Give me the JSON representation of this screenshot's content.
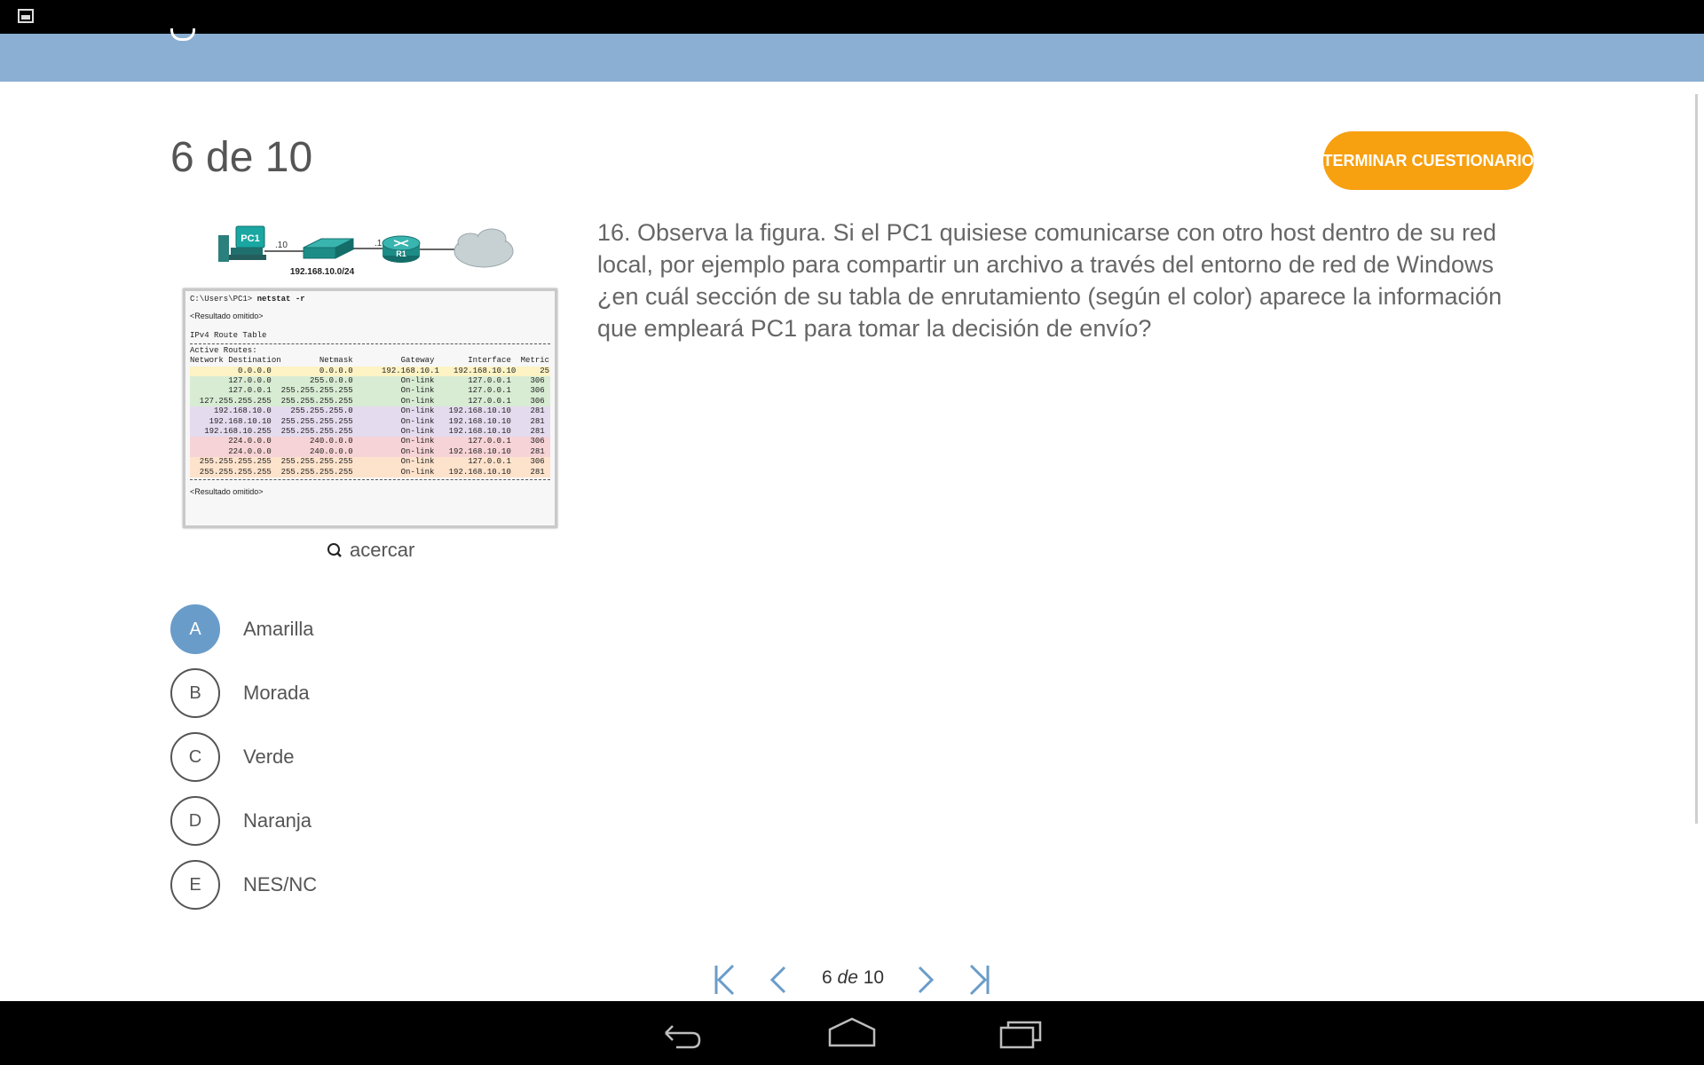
{
  "counter": "6 de 10",
  "finish_button": "TERMINAR CUESTIONARIO",
  "question": "16. Observa la figura. Si el PC1 quisiese comunicarse con otro host dentro de su red local, por ejemplo para compartir un archivo a través del entorno de red de Windows ¿en cuál sección de su tabla de enrutamiento (según el color) aparece la información que empleará PC1 para tomar la decisión de envío?",
  "zoom_label": "acercar",
  "figure": {
    "pc_label": "PC1",
    "pc_suffix": ".10",
    "router_label": "R1",
    "router_suffix": ".1",
    "network_label": "192.168.10.0/24",
    "command_prompt": "C:\\Users\\PC1> ",
    "command": "netstat -r",
    "omitted_top": "<Resultado omitido>",
    "table_title": "IPv4 Route Table",
    "active_routes": "Active Routes:",
    "header": "Network Destination        Netmask          Gateway       Interface  Metric",
    "rows": [
      {
        "color": "yellow",
        "text": "          0.0.0.0          0.0.0.0      192.168.10.1   192.168.10.10     25"
      },
      {
        "color": "green",
        "text": "        127.0.0.0        255.0.0.0          On-link       127.0.0.1    306"
      },
      {
        "color": "green",
        "text": "        127.0.0.1  255.255.255.255          On-link       127.0.0.1    306"
      },
      {
        "color": "green",
        "text": "  127.255.255.255  255.255.255.255          On-link       127.0.0.1    306"
      },
      {
        "color": "purple",
        "text": "     192.168.10.0    255.255.255.0          On-link   192.168.10.10    281"
      },
      {
        "color": "purple",
        "text": "    192.168.10.10  255.255.255.255          On-link   192.168.10.10    281"
      },
      {
        "color": "purple",
        "text": "   192.168.10.255  255.255.255.255          On-link   192.168.10.10    281"
      },
      {
        "color": "red",
        "text": "        224.0.0.0        240.0.0.0          On-link       127.0.0.1    306"
      },
      {
        "color": "red",
        "text": "        224.0.0.0        240.0.0.0          On-link   192.168.10.10    281"
      },
      {
        "color": "orange",
        "text": "  255.255.255.255  255.255.255.255          On-link       127.0.0.1    306"
      },
      {
        "color": "orange",
        "text": "  255.255.255.255  255.255.255.255          On-link   192.168.10.10    281"
      }
    ],
    "omitted_bottom": "<Resultado omitido>"
  },
  "options": [
    {
      "letter": "A",
      "label": "Amarilla",
      "selected": true
    },
    {
      "letter": "B",
      "label": "Morada",
      "selected": false
    },
    {
      "letter": "C",
      "label": "Verde",
      "selected": false
    },
    {
      "letter": "D",
      "label": "Naranja",
      "selected": false
    },
    {
      "letter": "E",
      "label": "NES/NC",
      "selected": false
    }
  ],
  "pager": {
    "current": "6",
    "sep": "de",
    "total": "10"
  },
  "colors": {
    "accent": "#6a9cc9",
    "appbar": "#8aafd2",
    "finish": "#f7a010"
  }
}
